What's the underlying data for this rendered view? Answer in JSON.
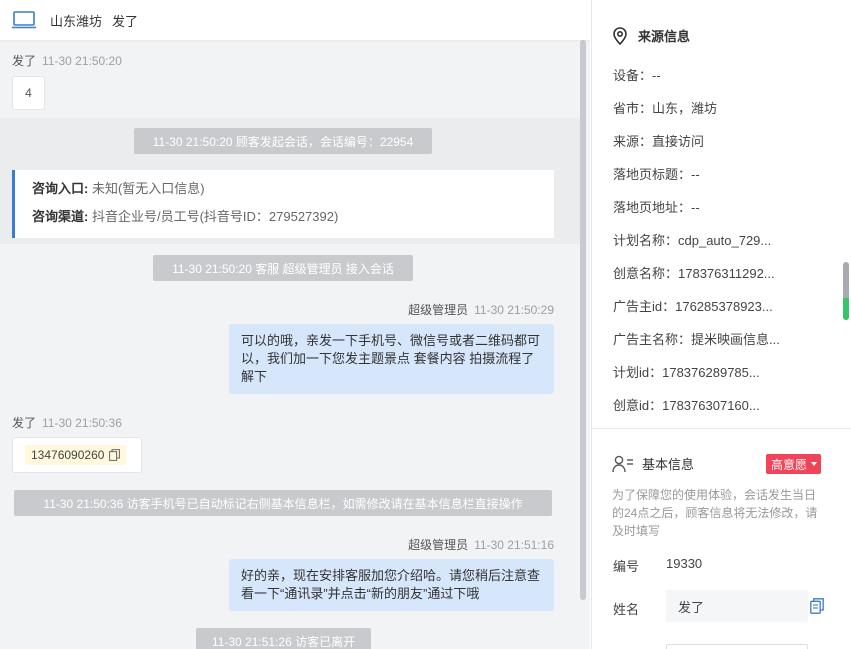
{
  "header": {
    "location": "山东潍坊",
    "visitor_name": "发了"
  },
  "messages": {
    "m1": {
      "sender": "发了",
      "time": "11-30 21:50:20",
      "text": "4"
    },
    "sys1": "11-30 21:50:20 顾客发起会话，会话编号：22954",
    "entry": {
      "entry_label": "咨询入口:",
      "entry_value": "未知(暂无入口信息)",
      "channel_label": "咨询渠道:",
      "channel_value": "抖音企业号/员工号(抖音号ID：279527392)"
    },
    "sys2": "11-30 21:50:20 客服 超级管理员 接入会话",
    "m2": {
      "sender": "超级管理员",
      "time": "11-30 21:50:29",
      "text": "可以的哦，亲发一下手机号、微信号或者二维码都可以，我们加一下您发主题景点 套餐内容 拍摄流程了解下"
    },
    "m3": {
      "sender": "发了",
      "time": "11-30 21:50:36",
      "phone": "13476090260"
    },
    "sys3": "11-30 21:50:36 访客手机号已自动标记右侧基本信息栏，如需修改请在基本信息栏直接操作",
    "m4": {
      "sender": "超级管理员",
      "time": "11-30 21:51:16",
      "text": "好的亲，现在安排客服加您介绍哈。请您稍后注意查看一下“通讯录”并点击“新的朋友”通过下哦"
    },
    "sys4": "11-30 21:51:26 访客已离开"
  },
  "source_info": {
    "title": "来源信息",
    "rows": [
      "设备：--",
      "省市：山东，潍坊",
      "来源：直接访问",
      "落地页标题：--",
      "落地页地址：--",
      "计划名称：cdp_auto_729...",
      "创意名称：178376311292...",
      "广告主id：176285378923...",
      "广告主名称：提米映画信息...",
      "计划id：178376289785...",
      "创意id：178376307160..."
    ]
  },
  "basic_info": {
    "title": "基本信息",
    "badge": "高意愿",
    "notice": "为了保障您的使用体验，会话发生当日的24点之后，顾客信息将无法修改，请及时填写",
    "id_label": "编号",
    "id_value": "19330",
    "name_label": "姓名",
    "name_value": "发了"
  },
  "colors": {
    "accent_blue": "#3a7bd5",
    "badge_red": "#f0445a",
    "out_bubble": "#d6e6fb"
  }
}
